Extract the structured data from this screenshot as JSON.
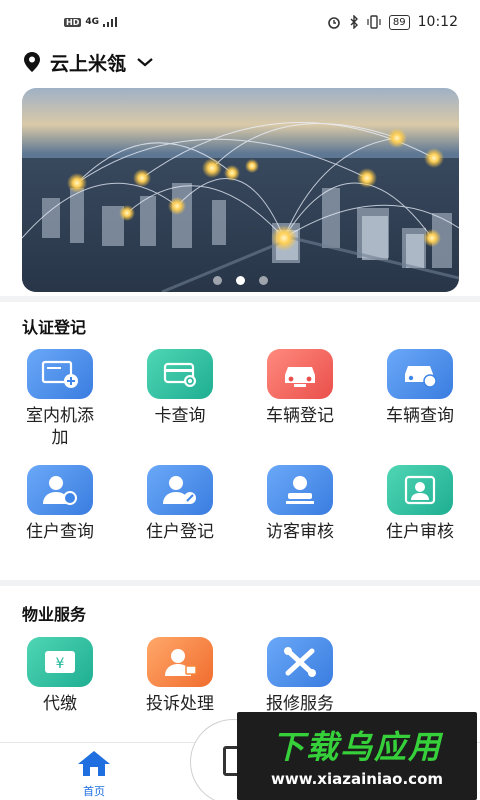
{
  "status_bar": {
    "hd": "HD",
    "signal": "4G",
    "battery": "89",
    "time": "10:12"
  },
  "location": {
    "name": "云上米瓴",
    "pin_icon": "location-pin-icon",
    "chevron_icon": "chevron-down-icon"
  },
  "banner": {
    "slide_count": 3,
    "active_index": 1
  },
  "sections": {
    "cert": {
      "title": "认证登记",
      "items": [
        {
          "label": "室内机添加",
          "icon": "indoor-unit-icon",
          "color": "#3f86e8"
        },
        {
          "label": "卡查询",
          "icon": "card-search-icon",
          "color": "#23b79a"
        },
        {
          "label": "车辆登记",
          "icon": "car-register-icon",
          "color": "#f0645f"
        },
        {
          "label": "车辆查询",
          "icon": "car-search-icon",
          "color": "#3f86e8"
        },
        {
          "label": "住户查询",
          "icon": "resident-search-icon",
          "color": "#3f86e8"
        },
        {
          "label": "住户登记",
          "icon": "resident-register-icon",
          "color": "#3f86e8"
        },
        {
          "label": "访客审核",
          "icon": "visitor-review-icon",
          "color": "#3f86e8"
        },
        {
          "label": "住户审核",
          "icon": "resident-review-icon",
          "color": "#23b79a"
        }
      ]
    },
    "property": {
      "title": "物业服务",
      "items": [
        {
          "label": "代缴",
          "icon": "payment-icon",
          "color": "#23b79a"
        },
        {
          "label": "投诉处理",
          "icon": "complaint-icon",
          "color": "#f5873a"
        },
        {
          "label": "报修服务",
          "icon": "repair-icon",
          "color": "#3f86e8"
        }
      ]
    }
  },
  "bottom_nav": {
    "home_label": "首页"
  },
  "watermark": {
    "main": "下载乌应用",
    "url": "www.xiazainiao.com"
  }
}
